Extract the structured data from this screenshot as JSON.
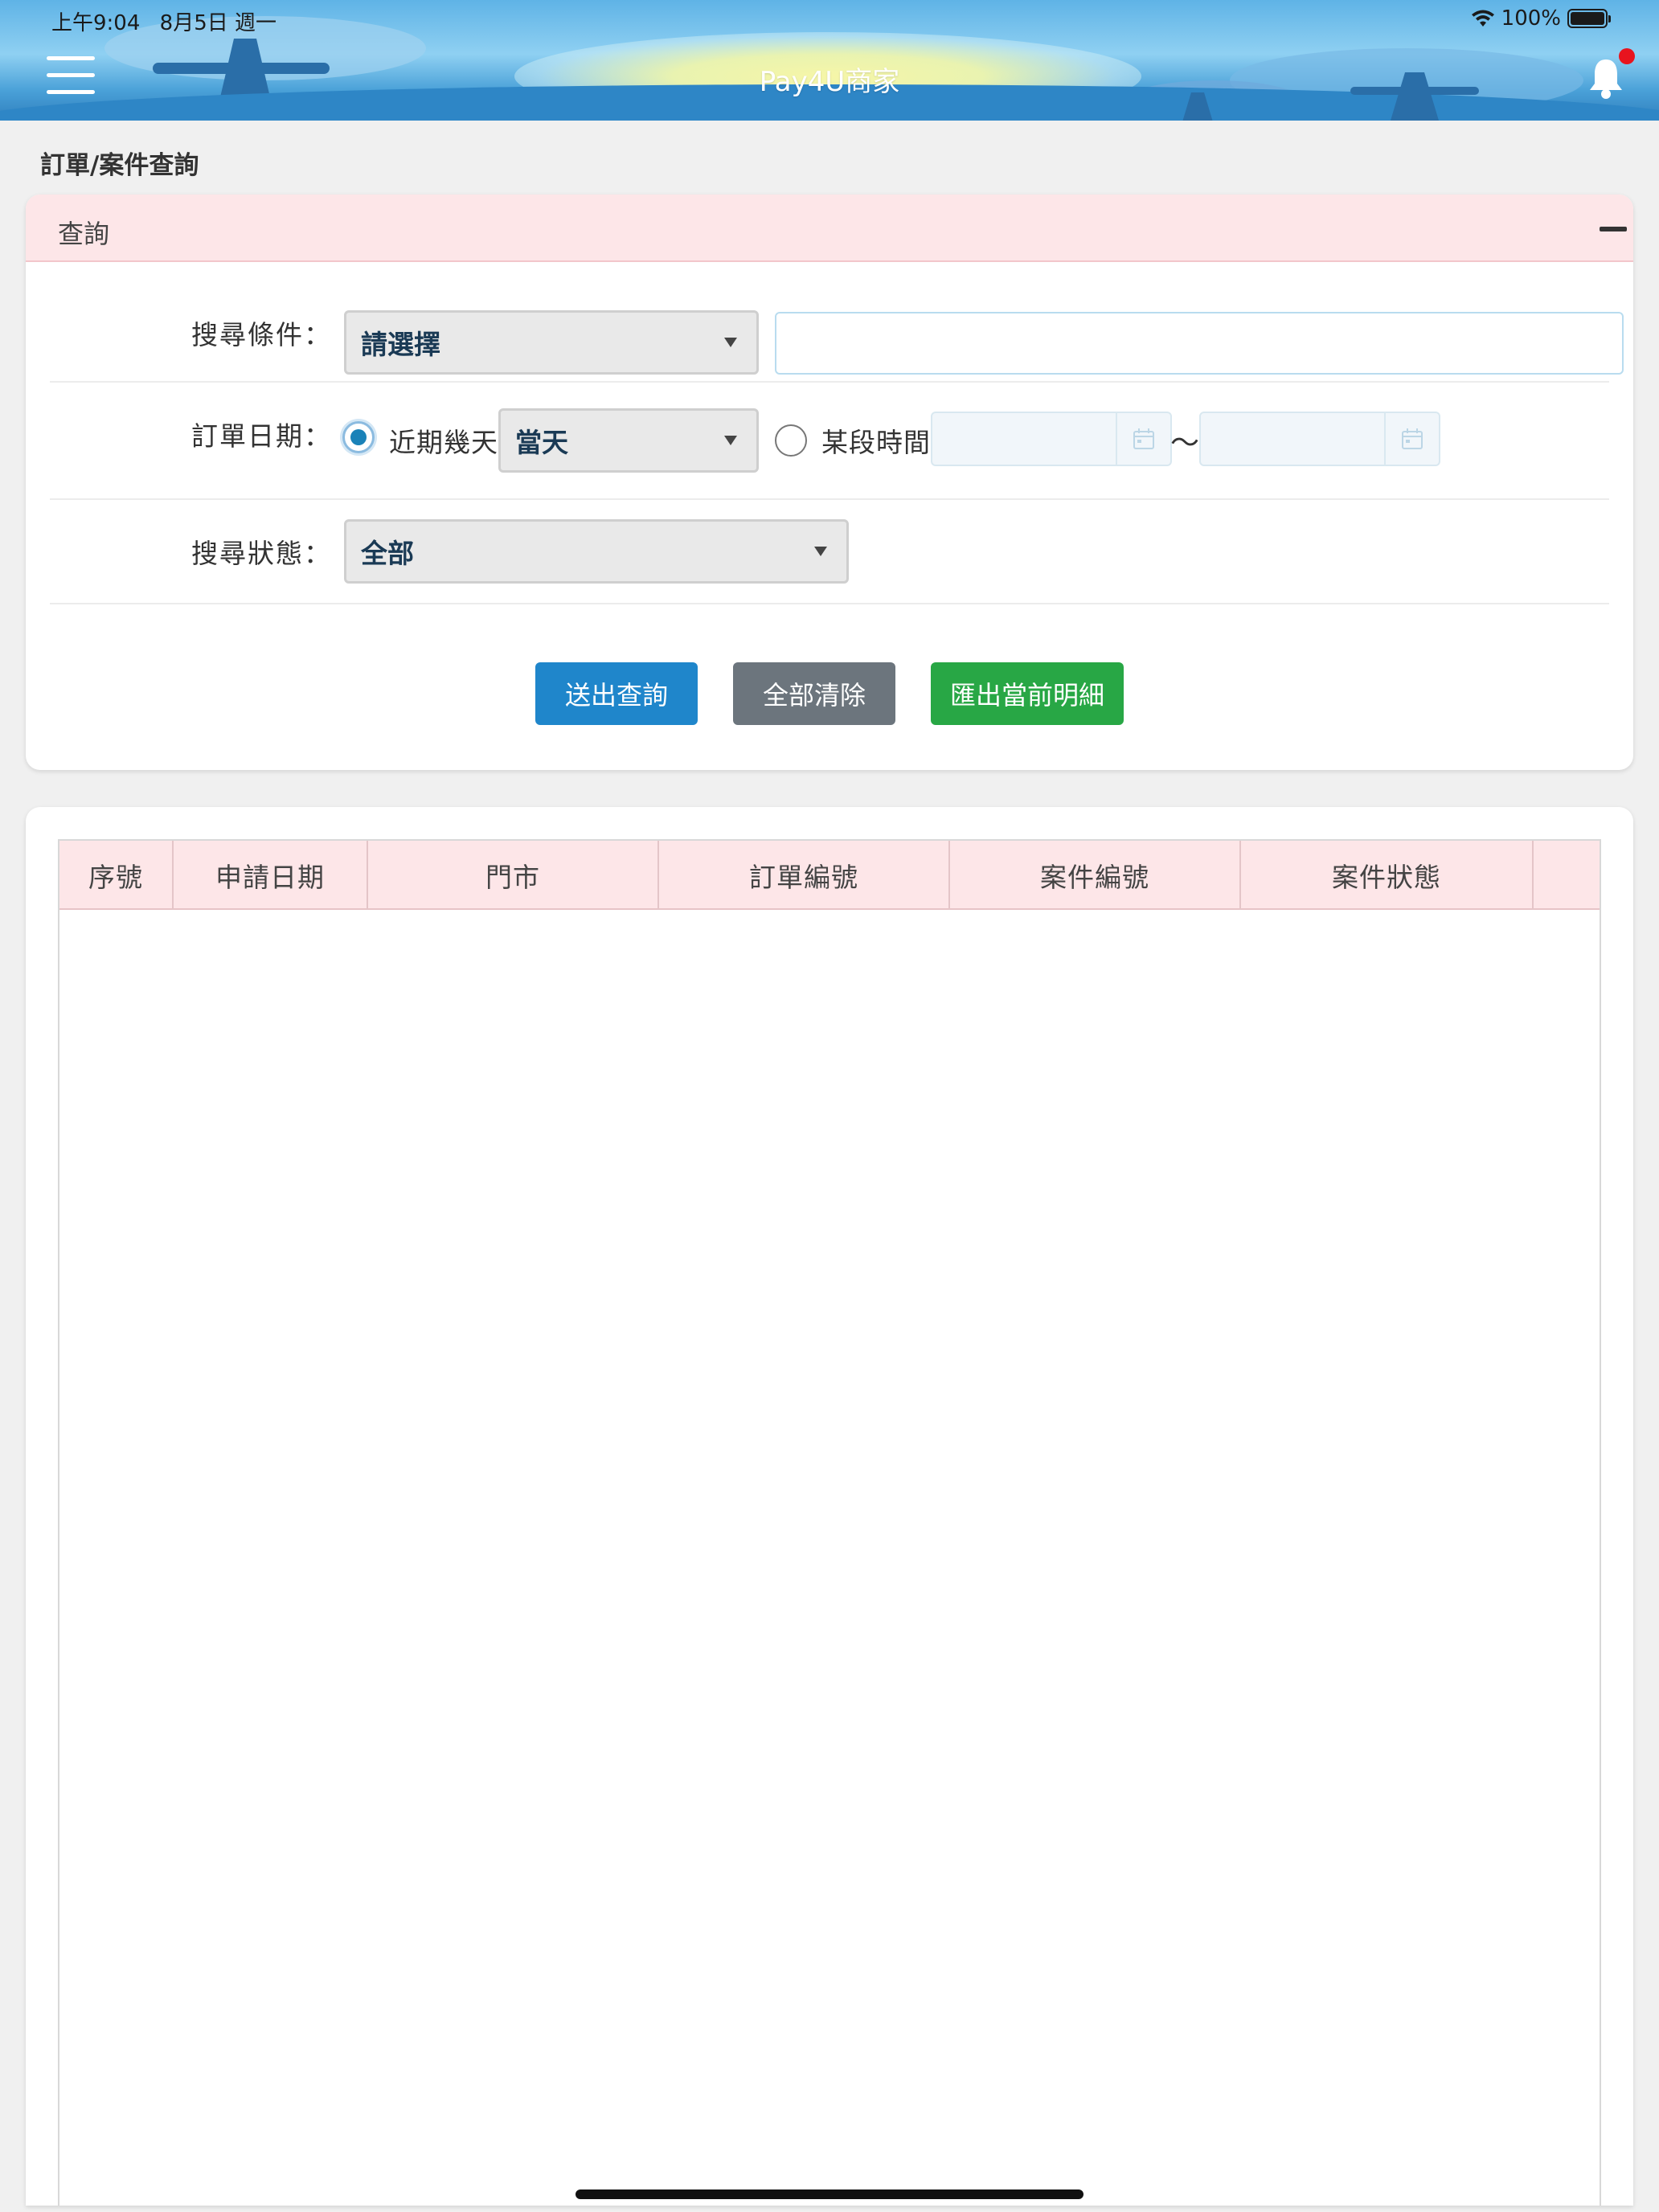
{
  "status_bar": {
    "time": "上午9:04",
    "date": "8月5日 週一",
    "battery": "100%"
  },
  "header": {
    "title": "Pay4U商家",
    "has_notification": true
  },
  "page": {
    "title": "訂單/案件查詢"
  },
  "query": {
    "panel_title": "查詢",
    "search_label": "搜尋條件：",
    "search_select": "請選擇",
    "search_value": "",
    "date_label": "訂單日期：",
    "recent_days_label": "近期幾天",
    "recent_days_checked": true,
    "recent_days_select": "當天",
    "period_label": "某段時間",
    "period_checked": false,
    "start_date": "",
    "end_date": "",
    "tilde": "～",
    "status_label": "搜尋狀態：",
    "status_select": "全部"
  },
  "actions": {
    "submit": "送出查詢",
    "clear": "全部清除",
    "export": "匯出當前明細"
  },
  "table": {
    "columns": [
      "序號",
      "申請日期",
      "門市",
      "訂單編號",
      "案件編號",
      "案件狀態",
      ""
    ],
    "rows": []
  },
  "colors": {
    "primary": "#1f86cb",
    "secondary": "#6c757d",
    "success": "#28a745",
    "panel_header": "#fde6e8",
    "notification_dot": "#e8141e"
  }
}
